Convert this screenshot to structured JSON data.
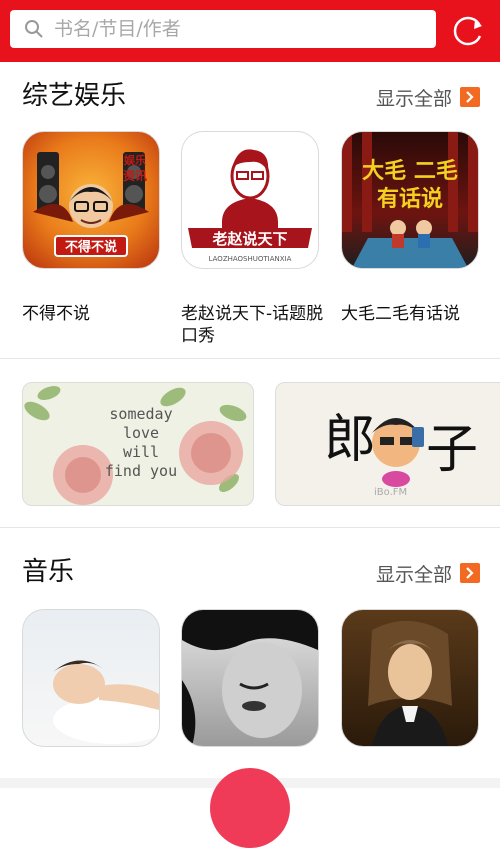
{
  "search": {
    "placeholder": "书名/节目/作者"
  },
  "sections": [
    {
      "title": "综艺娱乐",
      "show_all": "显示全部",
      "items": [
        {
          "title": "不得不说",
          "cover_text": [
            "娱乐",
            "资讯",
            "不得不说"
          ]
        },
        {
          "title": "老赵说天下-话题脱口秀",
          "cover_text": [
            "老赵说天下",
            "LAOZHAOSHUOTIANXIA"
          ]
        },
        {
          "title": "大毛二毛有话说",
          "cover_text": [
            "大毛 二毛",
            "有话说"
          ]
        }
      ]
    },
    {
      "title": "音乐",
      "show_all": "显示全部",
      "items": [
        {
          "title": ""
        },
        {
          "title": ""
        },
        {
          "title": ""
        }
      ]
    }
  ],
  "banners": [
    {
      "lines": [
        "someday",
        "love",
        "will",
        "find you"
      ]
    },
    {
      "text": "郎",
      "text2": "子",
      "watermark": "iBo.FM"
    }
  ],
  "colors": {
    "brand_red": "#e8121c",
    "accent_orange": "#f26a21"
  }
}
